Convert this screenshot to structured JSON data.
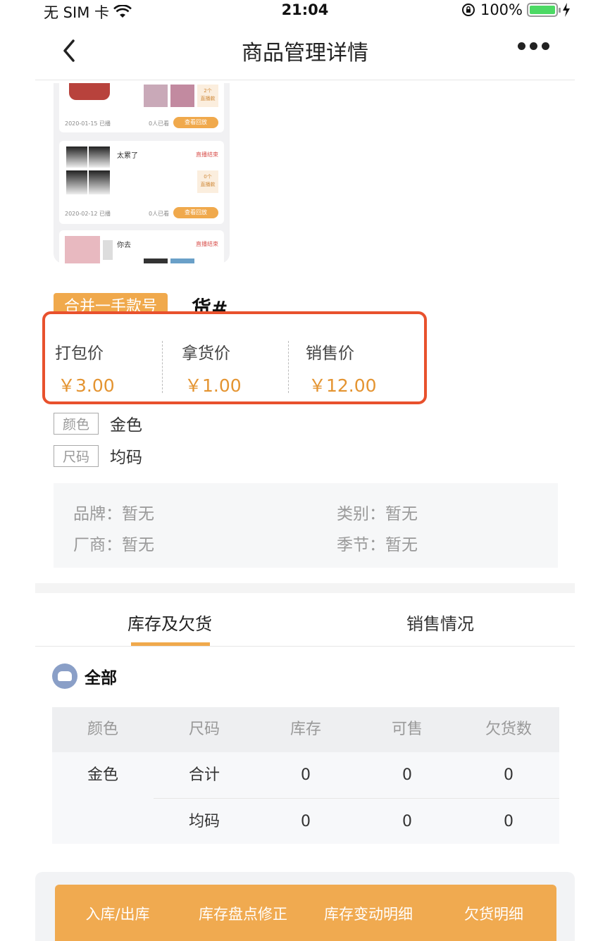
{
  "status": {
    "carrier": "无 SIM 卡",
    "time": "21:04",
    "battery": "100%",
    "battery_level": 1.0
  },
  "nav": {
    "title": "商品管理详情"
  },
  "thumbnail": {
    "cards": [
      {
        "badge_count": "2个",
        "badge_label": "直播款",
        "date": "2020-01-15 已播",
        "viewed": "0人已看",
        "button": "查看回放"
      },
      {
        "name": "太累了",
        "status": "直播结束",
        "badge_count": "0个",
        "badge_label": "直播款",
        "date": "2020-02-12 已播",
        "viewed": "0人已看",
        "button": "查看回放"
      },
      {
        "name": "你去",
        "status": "直播结束"
      }
    ]
  },
  "product": {
    "tag": "合并一手款号",
    "title": "货#",
    "prices": [
      {
        "label": "打包价",
        "value": "￥3.00"
      },
      {
        "label": "拿货价",
        "value": "￥1.00"
      },
      {
        "label": "销售价",
        "value": "￥12.00"
      }
    ],
    "attributes": [
      {
        "key": "颜色",
        "value": "金色"
      },
      {
        "key": "尺码",
        "value": "均码"
      }
    ],
    "info": {
      "brand": "品牌：暂无",
      "category": "类别：暂无",
      "vendor": "厂商：暂无",
      "season": "季节：暂无"
    }
  },
  "tabs": [
    {
      "label": "库存及欠货"
    },
    {
      "label": "销售情况"
    }
  ],
  "section": {
    "label": "全部"
  },
  "table": {
    "headers": [
      "颜色",
      "尺码",
      "库存",
      "可售",
      "欠货数"
    ],
    "color": "金色",
    "rows": [
      [
        "合计",
        "0",
        "0",
        "0"
      ],
      [
        "均码",
        "0",
        "0",
        "0"
      ]
    ]
  },
  "actions": [
    "入库/出库",
    "库存盘点修正",
    "库存变动明细",
    "欠货明细"
  ],
  "colors": {
    "accent": "#f0a94c",
    "price": "#e49431",
    "highlight": "#e8512d"
  }
}
